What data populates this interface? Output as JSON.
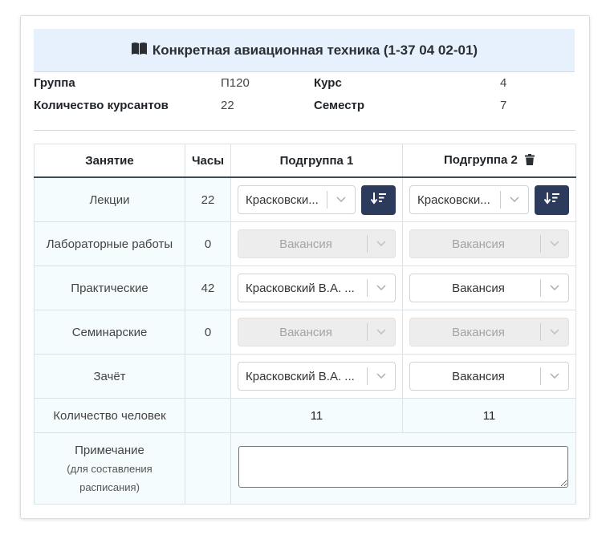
{
  "header": {
    "title": "Конкретная авиационная техника (1-37 04 02-01)",
    "icon": "book-icon"
  },
  "info": {
    "group_label": "Группа",
    "group_value": "П120",
    "course_label": "Курс",
    "course_value": "4",
    "students_label": "Количество курсантов",
    "students_value": "22",
    "semester_label": "Семестр",
    "semester_value": "7"
  },
  "table": {
    "headers": {
      "lesson": "Занятие",
      "hours": "Часы",
      "sub1": "Подгруппа 1",
      "sub2": "Подгруппа 2"
    },
    "rows": [
      {
        "lesson": "Лекции",
        "hours": "22",
        "sub1": "Красковски...",
        "sub2": "Красковски..."
      },
      {
        "lesson": "Лабораторные работы",
        "hours": "0",
        "sub1": "Вакансия",
        "sub2": "Вакансия"
      },
      {
        "lesson": "Практические",
        "hours": "42",
        "sub1": "Красковский В.А. ...",
        "sub2": "Вакансия"
      },
      {
        "lesson": "Семинарские",
        "hours": "0",
        "sub1": "Вакансия",
        "sub2": "Вакансия"
      },
      {
        "lesson": "Зачёт",
        "hours": "",
        "sub1": "Красковский В.А. ...",
        "sub2": "Вакансия"
      }
    ],
    "count": {
      "label": "Количество человек",
      "sub1": "11",
      "sub2": "11"
    },
    "note": {
      "label": "Примечание",
      "sublabel": "(для составления расписания)",
      "value": ""
    }
  },
  "colors": {
    "accent": "#2c3a5c",
    "header_bg": "#e7f1fd",
    "cell_bg": "#f5fcfe"
  }
}
